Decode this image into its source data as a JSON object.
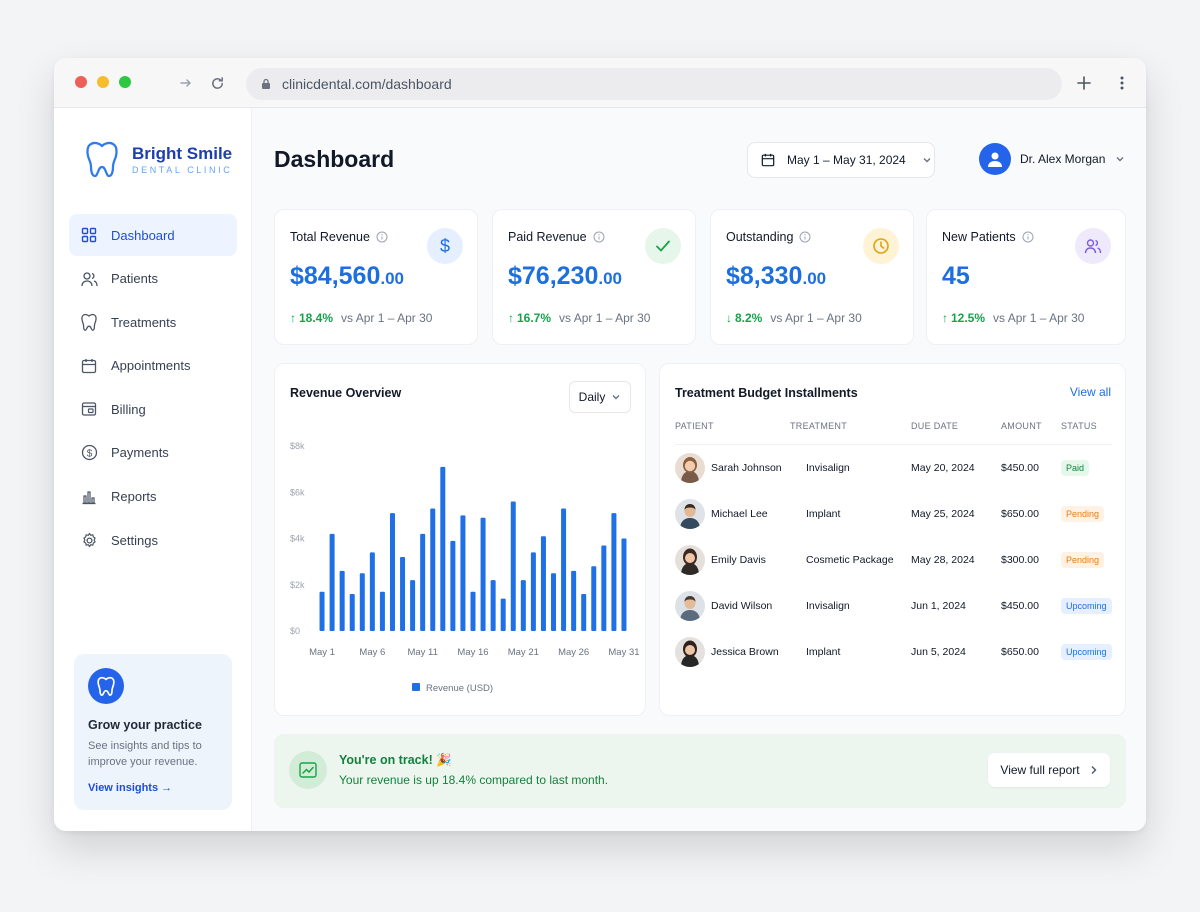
{
  "browser": {
    "url": "clinicdental.com/dashboard"
  },
  "brand": {
    "name": "Bright Smile",
    "sub": "DENTAL CLINIC"
  },
  "sidebar": {
    "items": [
      {
        "label": "Dashboard",
        "icon": "grid-icon"
      },
      {
        "label": "Patients",
        "icon": "users-icon"
      },
      {
        "label": "Treatments",
        "icon": "tooth-icon"
      },
      {
        "label": "Appointments",
        "icon": "calendar-icon"
      },
      {
        "label": "Billing",
        "icon": "billing-icon"
      },
      {
        "label": "Payments",
        "icon": "dollar-icon"
      },
      {
        "label": "Reports",
        "icon": "bar-chart-icon"
      },
      {
        "label": "Settings",
        "icon": "gear-icon"
      }
    ],
    "promo": {
      "title": "Grow your practice",
      "desc_line1": "See insights and tips to",
      "desc_line2": "improve your revenue.",
      "link": "View insights →"
    }
  },
  "header": {
    "title": "Dashboard",
    "date_range": "May 1 – May 31, 2024",
    "user": "Dr. Alex Morgan"
  },
  "stats": [
    {
      "label": "Total Revenue",
      "value_main": "$84,560",
      "value_cents": ".00",
      "pct": "18.4%",
      "arrow": "↑",
      "vs": "vs Apr 1 – Apr 30",
      "trend_color": "#16a34a",
      "icon": "dollar-icon"
    },
    {
      "label": "Paid Revenue",
      "value_main": "$76,230",
      "value_cents": ".00",
      "pct": "16.7%",
      "arrow": "↑",
      "vs": "vs Apr 1 – Apr 30",
      "trend_color": "#16a34a",
      "icon": "check-icon"
    },
    {
      "label": "Outstanding",
      "value_main": "$8,330",
      "value_cents": ".00",
      "pct": "8.2%",
      "arrow": "↓",
      "vs": "vs Apr 1 – Apr 30",
      "trend_color": "#16a34a",
      "icon": "clock-icon"
    },
    {
      "label": "New Patients",
      "value_main": "45",
      "value_cents": "",
      "pct": "12.5%",
      "arrow": "↑",
      "vs": "vs Apr 1 – Apr 30",
      "trend_color": "#16a34a",
      "icon": "users-icon"
    }
  ],
  "revenue_overview": {
    "title": "Revenue Overview",
    "period": "Daily"
  },
  "chart_data": {
    "type": "bar",
    "categories": [
      "May 1",
      "May 2",
      "May 3",
      "May 4",
      "May 5",
      "May 6",
      "May 7",
      "May 8",
      "May 9",
      "May 10",
      "May 11",
      "May 12",
      "May 13",
      "May 14",
      "May 15",
      "May 16",
      "May 17",
      "May 18",
      "May 19",
      "May 20",
      "May 21",
      "May 22",
      "May 23",
      "May 24",
      "May 25",
      "May 26",
      "May 27",
      "May 28",
      "May 29",
      "May 30",
      "May 31"
    ],
    "x_tick_labels": [
      "May 1",
      "May 6",
      "May 11",
      "May 16",
      "May 21",
      "May 26",
      "May 31"
    ],
    "series": [
      {
        "name": "Revenue (USD)",
        "values": [
          1700,
          4200,
          2600,
          1600,
          2500,
          3400,
          1700,
          5100,
          3200,
          2200,
          4200,
          5300,
          7100,
          3900,
          5000,
          1700,
          4900,
          2200,
          1400,
          5600,
          2200,
          3400,
          4100,
          2500,
          5300,
          2600,
          1600,
          2800,
          3700,
          5100,
          4000
        ],
        "color": "#1f6fe5"
      }
    ],
    "y_ticks": [
      "$0",
      "$2k",
      "$4k",
      "$6k",
      "$8k"
    ],
    "ylim": [
      0,
      8000
    ],
    "legend": "bottom"
  },
  "installments": {
    "title": "Treatment Budget Installments",
    "view_all": "View all",
    "headers": [
      "PATIENT",
      "TREATMENT",
      "DUE DATE",
      "AMOUNT",
      "STATUS"
    ],
    "rows": [
      {
        "patient": "Sarah Johnson",
        "treatment": "Invisalign",
        "due": "May 20, 2024",
        "amount": "$450.00",
        "status": "Paid",
        "status_kind": "paid"
      },
      {
        "patient": "Michael Lee",
        "treatment": "Implant",
        "due": "May 25, 2024",
        "amount": "$650.00",
        "status": "Pending",
        "status_kind": "pending"
      },
      {
        "patient": "Emily Davis",
        "treatment": "Cosmetic Package",
        "due": "May 28, 2024",
        "amount": "$300.00",
        "status": "Pending",
        "status_kind": "pending"
      },
      {
        "patient": "David Wilson",
        "treatment": "Invisalign",
        "due": "Jun 1, 2024",
        "amount": "$450.00",
        "status": "Upcoming",
        "status_kind": "upcoming"
      },
      {
        "patient": "Jessica Brown",
        "treatment": "Implant",
        "due": "Jun 5, 2024",
        "amount": "$650.00",
        "status": "Upcoming",
        "status_kind": "upcoming"
      }
    ]
  },
  "banner": {
    "title": "You're on track! 🎉",
    "desc": "Your revenue is up 18.4% compared to last month.",
    "button": "View full report"
  },
  "colors": {
    "accent": "#1d6fe0",
    "success": "#16a34a",
    "warning": "#ea7c0b"
  }
}
